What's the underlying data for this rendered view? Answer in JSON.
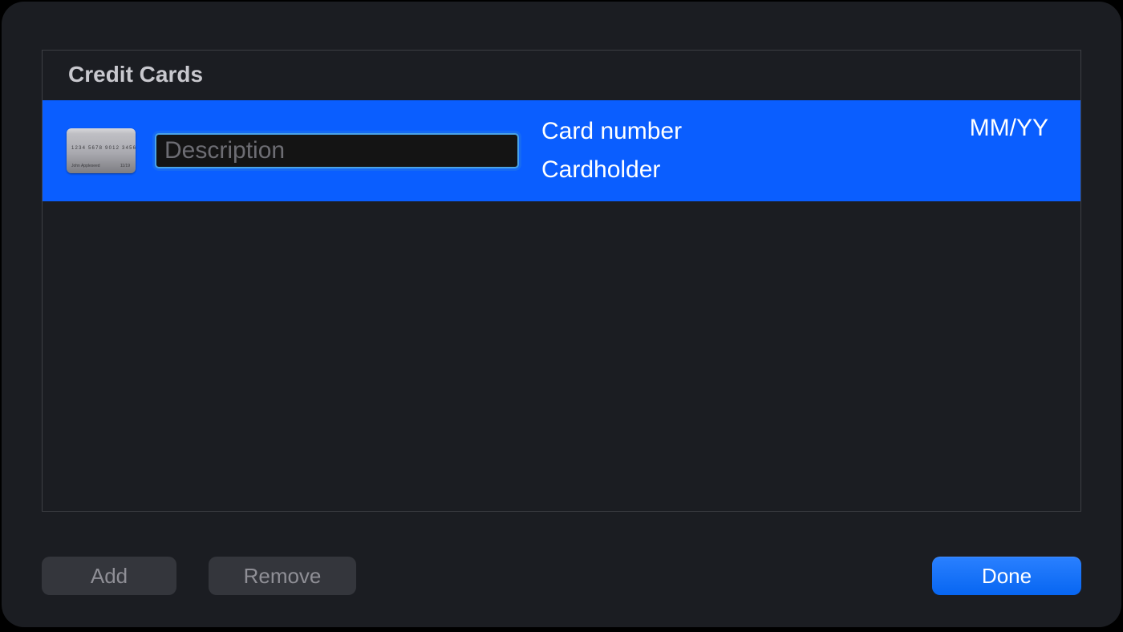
{
  "panel": {
    "title": "Credit Cards"
  },
  "row": {
    "description_placeholder": "Description",
    "description_value": "",
    "card_number_label": "Card number",
    "cardholder_label": "Cardholder",
    "expiry_label": "MM/YY",
    "icon": {
      "sample_number": "1234  5678  9012  3456",
      "sample_name": "John Appleseed",
      "sample_exp": "11/19"
    }
  },
  "buttons": {
    "add": "Add",
    "remove": "Remove",
    "done": "Done"
  }
}
